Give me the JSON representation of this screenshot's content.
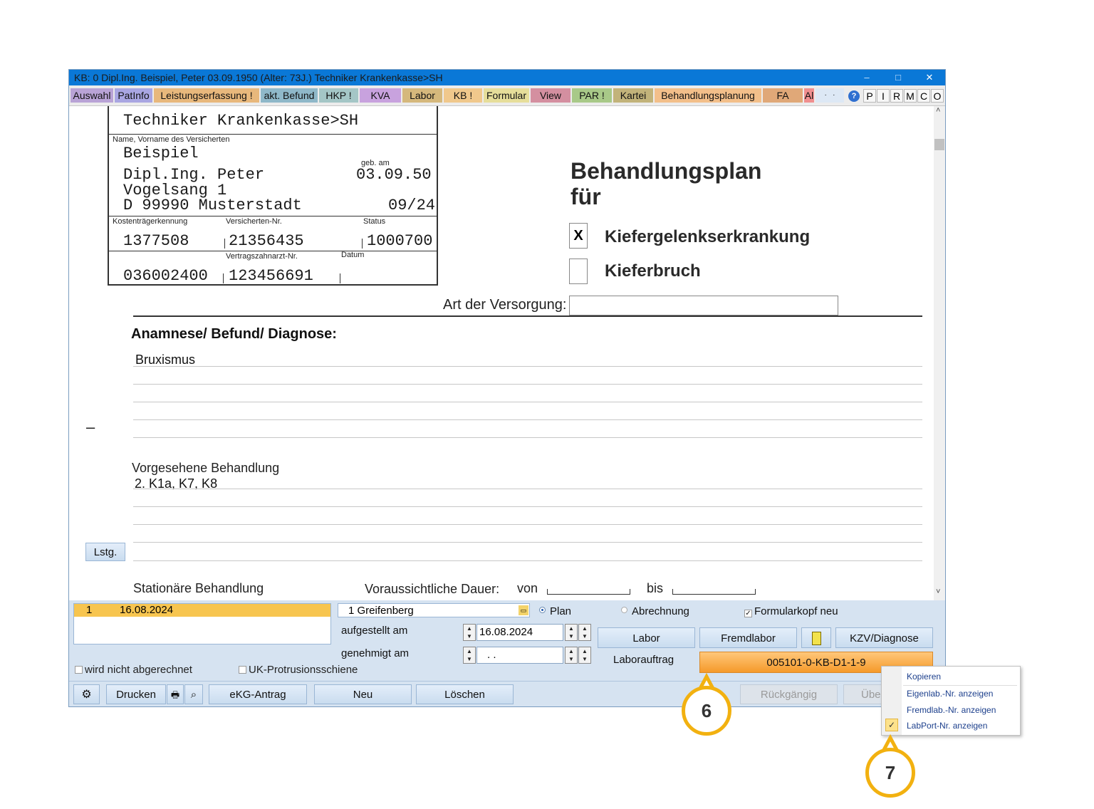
{
  "window": {
    "title": "KB: 0  Dipl.Ing. Beispiel, Peter  03.09.1950 (Alter: 73J.)  Techniker Krankenkasse>SH",
    "controls": [
      "–",
      "□",
      "✕"
    ]
  },
  "tabs": [
    {
      "label": "Auswahl",
      "bg": "#b9a3d6"
    },
    {
      "label": "PatInfo",
      "bg": "#a9a6e2"
    },
    {
      "label": "Leistungserfassung !",
      "bg": "#e8b87c"
    },
    {
      "label": "akt. Befund",
      "bg": "#8fb8c9"
    },
    {
      "label": "HKP !",
      "bg": "#a4c6c6"
    },
    {
      "label": "KVA",
      "bg": "#c8a2de"
    },
    {
      "label": "Labor",
      "bg": "#d5b87c"
    },
    {
      "label": "KB !",
      "bg": "#f0c88c"
    },
    {
      "label": "Formular",
      "bg": "#e6de9a"
    },
    {
      "label": "View",
      "bg": "#d48fa0"
    },
    {
      "label": "PAR !",
      "bg": "#a8c988"
    },
    {
      "label": "Kartei",
      "bg": "#c2b37a"
    },
    {
      "label": "Behandlungsplanung",
      "bg": "#f3bf8a"
    },
    {
      "label": "FA",
      "bg": "#e0a878"
    },
    {
      "label": "Al",
      "bg": "#f08f8f"
    }
  ],
  "letter_tabs": [
    "P",
    "I",
    "R",
    "M",
    "C",
    "O"
  ],
  "form": {
    "kasse": "Techniker Krankenkasse>SH",
    "name_label": "Name, Vorname des Versicherten",
    "surname": "Beispiel",
    "firstname": "Dipl.Ing. Peter",
    "geb_label": "geb. am",
    "geb": "03.09.50",
    "street": "Vogelsang 1",
    "city": "D 99990 Musterstadt",
    "valid": "09/24",
    "kostentraeger_label": "Kostenträgerkennung",
    "versicherten_label": "Versicherten-Nr.",
    "status_label": "Status",
    "kostentraeger": "1377508",
    "versicherten": "21356435",
    "status": "1000700",
    "vertragszahnarzt_label": "Vertragszahnarzt-Nr.",
    "datum_label": "Datum",
    "betriebsstaette": "036002400",
    "vertragszahnarzt": "123456691",
    "plan_title_1": "Behandlungsplan",
    "plan_title_2": "für",
    "opt1_mark": "X",
    "opt1": "Kiefergelenkserkrankung",
    "opt2": "Kieferbruch",
    "art_label": "Art der Versorgung:",
    "anamnese_label": "Anamnese/ Befund/ Diagnose:",
    "anamnese_text": "Bruxismus",
    "dash": "–",
    "behandlung_label": "Vorgesehene Behandlung",
    "behandlung_text": "2. K1a, K7, K8",
    "lstg": "Lstg.",
    "stationaer": "Stationäre Behandlung",
    "dauer_label": "Voraussichtliche Dauer:",
    "von": "von",
    "bis": "bis"
  },
  "bottom": {
    "list_row": {
      "nr": "1",
      "date": "16.08.2024"
    },
    "location": "1 Greifenberg",
    "radio_plan": "Plan",
    "radio_abrechnung": "Abrechnung",
    "formularkopf": "Formularkopf neu",
    "aufgestellt_label": "aufgestellt am",
    "aufgestellt_value": "16.08.2024",
    "genehmigt_label": "genehmigt am",
    "genehmigt_value": " .  .",
    "labor_btn": "Labor",
    "fremdlabor_btn": "Fremdlabor",
    "kzv_btn": "KZV/Diagnose",
    "laborauftrag_label": "Laborauftrag",
    "laborauftrag_value": "005101-0-KB-D1-1-9",
    "wird_nicht": "wird nicht abgerechnet",
    "uk_protrusion": "UK-Protrusionsschiene",
    "drucken": "Drucken",
    "ekg": "eKG-Antrag",
    "neu": "Neu",
    "loeschen": "Löschen",
    "rueckgaengig": "Rückgängig",
    "uebernehmen_partial": "Übe"
  },
  "context_menu": {
    "items": [
      "Kopieren",
      "Eigenlab.-Nr. anzeigen",
      "Fremdlab.-Nr. anzeigen",
      "LabPort-Nr. anzeigen"
    ],
    "checked": "LabPort-Nr. anzeigen"
  },
  "callouts": [
    "6",
    "7"
  ]
}
